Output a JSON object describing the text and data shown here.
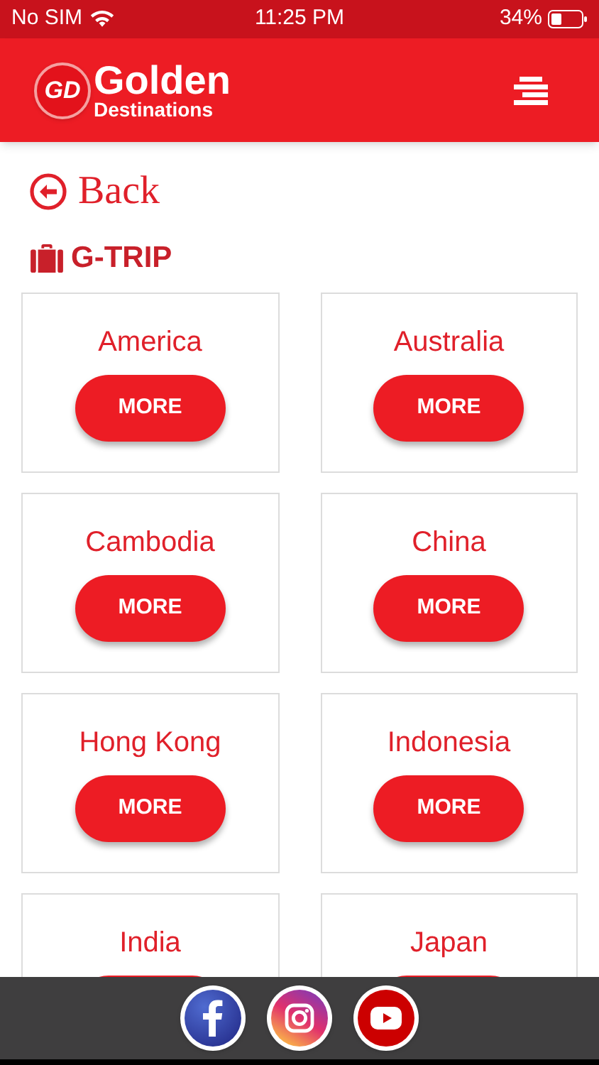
{
  "status_bar": {
    "carrier": "No SIM",
    "time": "11:25 PM",
    "battery": "34%"
  },
  "header": {
    "logo_mark": "GD",
    "logo_title": "Golden",
    "logo_subtitle": "Destinations"
  },
  "back": {
    "label": "Back"
  },
  "section": {
    "title": "G-TRIP"
  },
  "destinations": [
    {
      "name": "America",
      "button": "MORE"
    },
    {
      "name": "Australia",
      "button": "MORE"
    },
    {
      "name": "Cambodia",
      "button": "MORE"
    },
    {
      "name": "China",
      "button": "MORE"
    },
    {
      "name": "Hong Kong",
      "button": "MORE"
    },
    {
      "name": "Indonesia",
      "button": "MORE"
    },
    {
      "name": "India"
    },
    {
      "name": "Japan"
    }
  ],
  "social": [
    {
      "kind": "facebook"
    },
    {
      "kind": "instagram"
    },
    {
      "kind": "youtube"
    }
  ]
}
